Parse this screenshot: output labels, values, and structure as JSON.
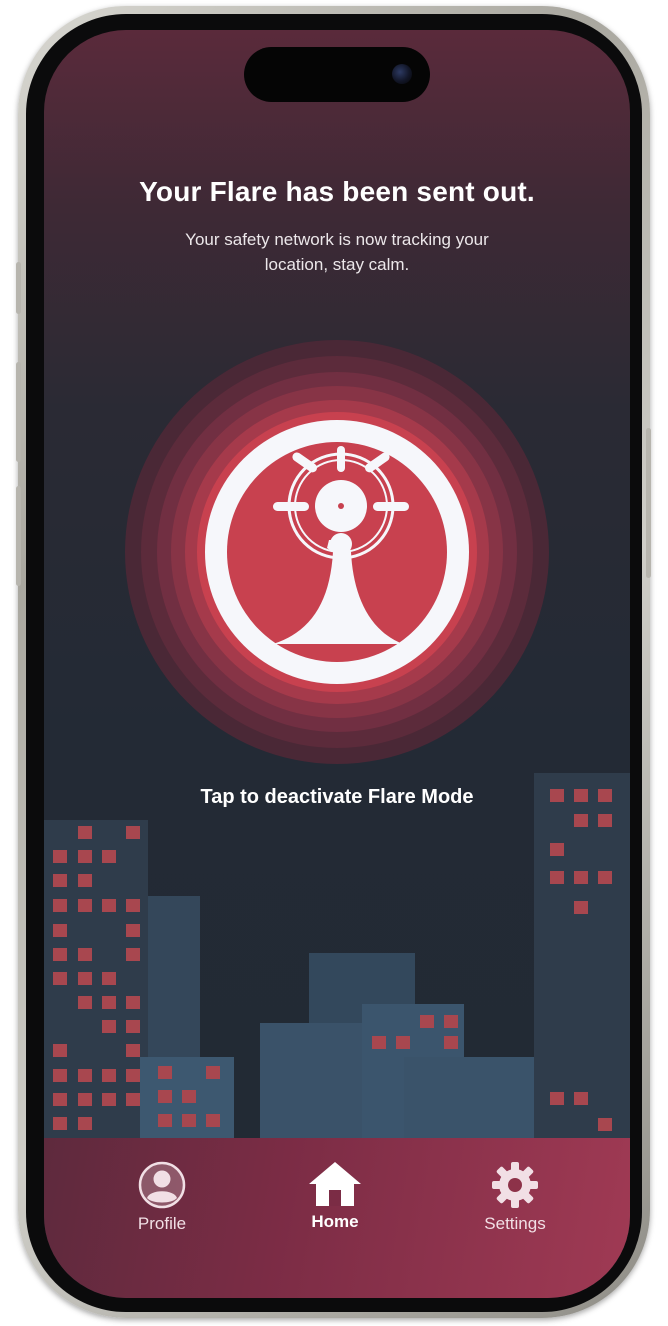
{
  "alert": {
    "headline": "Your Flare has been sent out.",
    "subtext": "Your safety network is now tracking your location, stay calm."
  },
  "flare_button": {
    "icon": "flare-beacon-icon",
    "cta": "Tap to deactivate Flare Mode",
    "accent_color": "#c8414f"
  },
  "nav": {
    "items": [
      {
        "label": "Profile",
        "icon": "profile-icon"
      },
      {
        "label": "Home",
        "icon": "home-icon",
        "active": true
      },
      {
        "label": "Settings",
        "icon": "gear-icon"
      }
    ]
  },
  "colors": {
    "background_top": "#5a2a3b",
    "background_bottom": "#222a34",
    "nav_bar": "#a03a54",
    "window_lights": "#b04a57"
  }
}
